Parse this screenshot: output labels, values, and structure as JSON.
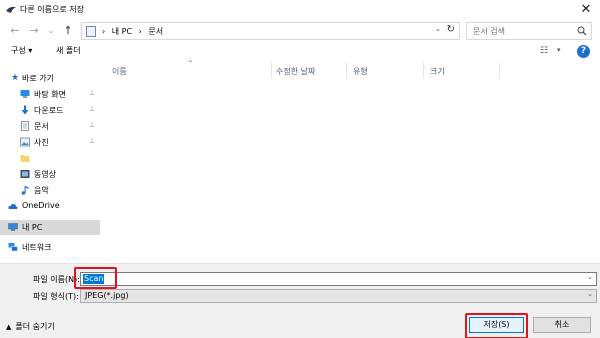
{
  "window": {
    "title": "다른 이름으로 저장",
    "close_glyph": "✕"
  },
  "nav": {
    "back_glyph": "←",
    "forward_glyph": "→",
    "recent_glyph": "⌄",
    "up_glyph": "↑",
    "path": [
      "내 PC",
      "문서"
    ],
    "separator": "›",
    "search_placeholder": "문서 검색"
  },
  "toolbar": {
    "organize_label": "구성 ▾",
    "new_folder_label": "새 폴더",
    "help_glyph": "?"
  },
  "sidebar": {
    "items": [
      {
        "label": "바로 가기",
        "icon": "star-icon",
        "pinned": false
      },
      {
        "label": "바탕 화면",
        "icon": "desktop-icon",
        "pinned": true
      },
      {
        "label": "다운로드",
        "icon": "download-icon",
        "pinned": true
      },
      {
        "label": "문서",
        "icon": "document-icon",
        "pinned": true
      },
      {
        "label": "사진",
        "icon": "picture-icon",
        "pinned": true
      },
      {
        "label": "",
        "icon": "folder-icon",
        "pinned": false
      },
      {
        "label": "동영상",
        "icon": "video-icon",
        "pinned": false
      },
      {
        "label": "음악",
        "icon": "music-icon",
        "pinned": false
      },
      {
        "label": "OneDrive",
        "icon": "cloud-icon",
        "pinned": false
      },
      {
        "label": "내 PC",
        "icon": "pc-icon",
        "pinned": false,
        "selected": true
      },
      {
        "label": "네트워크",
        "icon": "network-icon",
        "pinned": false
      }
    ],
    "pin_glyph": "📌"
  },
  "columns": {
    "name": "이름",
    "modified": "수정한 날짜",
    "type": "유형",
    "size": "크기"
  },
  "form": {
    "filename_label": "파일 이름(N):",
    "filename_value": "Scan",
    "filetype_label": "파일 형식(T):",
    "filetype_value": "JPEG(*.jpg)"
  },
  "footer": {
    "hide_folders_label": "폴더 숨기기",
    "save_label": "저장(S)",
    "cancel_label": "취소"
  },
  "colors": {
    "accent": "#0078d7",
    "highlight": "#e0141e",
    "selected_bg": "#d9d9d9"
  }
}
